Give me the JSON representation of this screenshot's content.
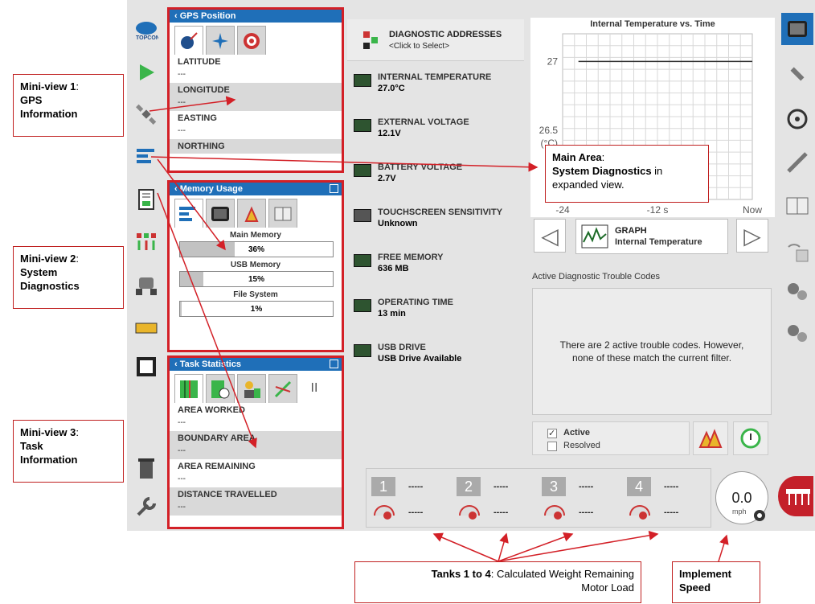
{
  "gps_view": {
    "title": "GPS Position",
    "fields": [
      {
        "label": "LATITUDE",
        "value": "---"
      },
      {
        "label": "LONGITUDE",
        "value": "---"
      },
      {
        "label": "EASTING",
        "value": "---"
      },
      {
        "label": "NORTHING",
        "value": ""
      }
    ]
  },
  "memory_view": {
    "title": "Memory Usage",
    "rows": [
      {
        "label": "Main Memory",
        "value": "36%",
        "fraction": 0.36
      },
      {
        "label": "USB Memory",
        "value": "15%",
        "fraction": 0.15
      },
      {
        "label": "File System",
        "value": "1%",
        "fraction": 0.01
      }
    ]
  },
  "task_view": {
    "title": "Task Statistics",
    "pause_glyph": "II",
    "fields": [
      {
        "label": "AREA WORKED",
        "value": "---"
      },
      {
        "label": "BOUNDARY AREA",
        "value": "---"
      },
      {
        "label": "AREA REMAINING",
        "value": "---"
      },
      {
        "label": "DISTANCE TRAVELLED",
        "value": "---"
      }
    ]
  },
  "diagnostics": {
    "address_title": "DIAGNOSTIC ADDRESSES",
    "address_hint": "<Click to Select>",
    "items": [
      {
        "name": "INTERNAL TEMPERATURE",
        "value": "27.0°C"
      },
      {
        "name": "EXTERNAL VOLTAGE",
        "value": "12.1V"
      },
      {
        "name": "BATTERY VOLTAGE",
        "value": "2.7V"
      },
      {
        "name": "TOUCHSCREEN SENSITIVITY",
        "value": "Unknown"
      },
      {
        "name": "FREE MEMORY",
        "value": "636 MB"
      },
      {
        "name": "OPERATING TIME",
        "value": "13 min"
      },
      {
        "name": "USB DRIVE",
        "value": "USB Drive Available"
      }
    ]
  },
  "chart_data": {
    "type": "line",
    "title": "Internal Temperature vs. Time",
    "ylabel": "(°C)",
    "xlabel": "",
    "yticks": [
      "27",
      "26.5"
    ],
    "xticks": [
      "-24",
      "-12 s",
      "Now"
    ],
    "ylim": [
      26.0,
      27.2
    ],
    "xlim": [
      -24,
      0
    ],
    "series": [
      {
        "x": [
          -22,
          0
        ],
        "values": [
          27.0,
          27.0
        ]
      }
    ]
  },
  "graph_selector": {
    "title": "GRAPH",
    "subtitle": "Internal Temperature",
    "prev": "◁",
    "next": "▷"
  },
  "dtc": {
    "title": "Active Diagnostic Trouble Codes",
    "message": "There are 2 active trouble codes. However, none of these match the current filter.",
    "filter_active": "Active",
    "filter_resolved": "Resolved"
  },
  "tanks": [
    {
      "number": "1",
      "weight": "-----",
      "motor": "-----"
    },
    {
      "number": "2",
      "weight": "-----",
      "motor": "-----"
    },
    {
      "number": "3",
      "weight": "-----",
      "motor": "-----"
    },
    {
      "number": "4",
      "weight": "-----",
      "motor": "-----"
    }
  ],
  "speed": {
    "value": "0.0",
    "unit": "mph"
  },
  "annotations": {
    "mv1": {
      "bold": "Mini-view 1",
      "rest": ":",
      "line2": "GPS",
      "line3": "Information"
    },
    "mv2": {
      "bold": "Mini-view 2",
      "rest": ":",
      "line2": "System",
      "line3": "Diagnostics"
    },
    "mv3": {
      "bold": "Mini-view 3",
      "rest": ":",
      "line2": "Task",
      "line3": "Information"
    },
    "main": {
      "bold1": "Main Area",
      "rest1": ":",
      "bold2": "System Diagnostics",
      "rest2": " in",
      "line3": "expanded view."
    },
    "tanks": {
      "bold": "Tanks 1 to 4",
      "rest": ": Calculated Weight Remaining",
      "line2": "Motor Load"
    },
    "speed": {
      "line1": "Implement",
      "line2": "Speed"
    }
  },
  "colors": {
    "accent": "#1f6fb8",
    "annotation": "#d32027",
    "led_green": "#2e5430"
  }
}
